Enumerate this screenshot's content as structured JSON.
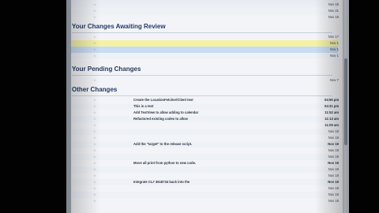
{
  "sections": {
    "review": "Your Changes Awaiting Review",
    "pending": "Your Pending Changes",
    "other": "Other Changes"
  },
  "rows": {
    "top": [
      {
        "id": "",
        "star": "☆",
        "owner": "",
        "subject": "",
        "status": "",
        "date": "Nov 18"
      },
      {
        "id": "",
        "star": "☆",
        "owner": "",
        "subject": "",
        "status": "",
        "date": "Nov 21"
      },
      {
        "id": "",
        "star": "☆",
        "owner": "",
        "subject": "",
        "status": "",
        "date": "Nov 18"
      }
    ],
    "review": [
      {
        "id": "",
        "star": "☆",
        "owner": "",
        "subject": "",
        "status": "",
        "date": "Nov 17"
      },
      {
        "id": "",
        "star": "☆",
        "owner": "",
        "subject": "",
        "status": "",
        "date": "Nov 1"
      },
      {
        "id": "",
        "star": "☆",
        "owner": "",
        "subject": "",
        "status": "",
        "date": "Nov 1"
      },
      {
        "id": "",
        "star": "☆",
        "owner": "",
        "subject": "",
        "status": "",
        "date": "Nov 1"
      }
    ],
    "pending": [
      {
        "id": "",
        "star": "☆",
        "owner": "",
        "subject": "",
        "status": "",
        "date": "Nov 7"
      }
    ],
    "other": [
      {
        "id": "",
        "star": "☆",
        "owner": "",
        "subject": "Create the LocationFetcher/Client test",
        "status": "",
        "date": "04:55 pm"
      },
      {
        "id": "",
        "star": "☆",
        "owner": "",
        "subject": "This is a test",
        "status": "",
        "date": "04:31 pm"
      },
      {
        "id": "",
        "star": "☆",
        "owner": "",
        "subject": "Add TextView to allow adding to calendar",
        "status": "",
        "date": "11:52 am"
      },
      {
        "id": "",
        "star": "☆",
        "owner": "",
        "subject": "Refactored existing codes to allow",
        "status": "",
        "date": "11:13 am"
      },
      {
        "id": "",
        "star": "☆",
        "owner": "",
        "subject": "",
        "status": "",
        "date": "11:05 am"
      },
      {
        "id": "",
        "star": "☆",
        "owner": "",
        "subject": "",
        "status": "",
        "date": "Nov 19"
      },
      {
        "id": "",
        "star": "☆",
        "owner": "",
        "subject": "",
        "status": "",
        "date": "Nov 19"
      },
      {
        "id": "",
        "star": "☆",
        "owner": "",
        "subject": "Add the \"target\" to the release script.",
        "status": "",
        "date": "Nov 19"
      },
      {
        "id": "",
        "star": "☆",
        "owner": "",
        "subject": "",
        "status": "",
        "date": "Nov 19"
      },
      {
        "id": "",
        "star": "☆",
        "owner": "",
        "subject": "",
        "status": "",
        "date": "Nov 19"
      },
      {
        "id": "",
        "star": "☆",
        "owner": "",
        "subject": "Move all print from python to new code.",
        "status": "",
        "date": "Nov 19"
      },
      {
        "id": "",
        "star": "☆",
        "owner": "",
        "subject": "",
        "status": "",
        "date": "Nov 19"
      },
      {
        "id": "",
        "star": "☆",
        "owner": "",
        "subject": "",
        "status": "",
        "date": "Nov 19"
      },
      {
        "id": "",
        "star": "☆",
        "owner": "",
        "subject": "Integrate CL# 3618734 back into the",
        "status": "",
        "date": "Nov 19"
      },
      {
        "id": "",
        "star": "☆",
        "owner": "",
        "subject": "",
        "status": "",
        "date": "Nov 19"
      },
      {
        "id": "",
        "star": "☆",
        "owner": "",
        "subject": "",
        "status": "",
        "date": "Nov 19"
      },
      {
        "id": "",
        "star": "☆",
        "owner": "",
        "subject": "",
        "status": "",
        "date": "Nov 18"
      }
    ]
  }
}
